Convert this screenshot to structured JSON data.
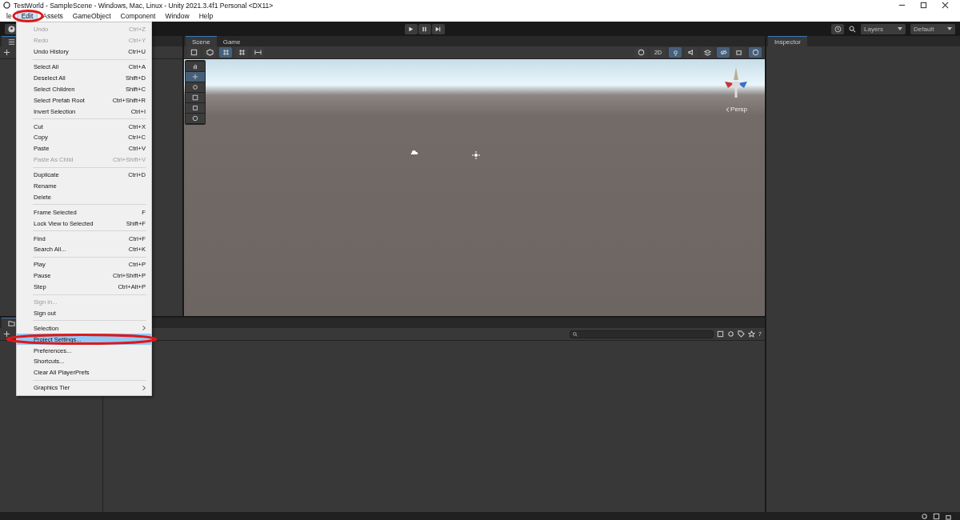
{
  "window": {
    "title": "TestWorld - SampleScene - Windows, Mac, Linux - Unity 2021.3.4f1 Personal <DX11>"
  },
  "menu_bar": [
    {
      "label": "le",
      "selected": false
    },
    {
      "label": "Edit",
      "selected": true
    },
    {
      "label": "Assets",
      "selected": false
    },
    {
      "label": "GameObject",
      "selected": false
    },
    {
      "label": "Component",
      "selected": false
    },
    {
      "label": "Window",
      "selected": false
    },
    {
      "label": "Help",
      "selected": false
    }
  ],
  "toolbar": {
    "layers": "Layers",
    "layout": "Default"
  },
  "scene_tabs": [
    {
      "label": "Scene",
      "selected": true
    },
    {
      "label": "Game",
      "selected": false
    }
  ],
  "scene_view": {
    "toolbar_2d": "2D",
    "camera_label": "Persp"
  },
  "inspector": {
    "tab": "Inspector"
  },
  "edit_menu": [
    {
      "kind": "item",
      "label": "Undo",
      "shortcut": "Ctrl+Z",
      "disabled": true,
      "selected": false
    },
    {
      "kind": "item",
      "label": "Redo",
      "shortcut": "Ctrl+Y",
      "disabled": true,
      "selected": false
    },
    {
      "kind": "item",
      "label": "Undo History",
      "shortcut": "Ctrl+U",
      "disabled": false,
      "selected": false
    },
    {
      "kind": "separator"
    },
    {
      "kind": "item",
      "label": "Select All",
      "shortcut": "Ctrl+A",
      "disabled": false,
      "selected": false
    },
    {
      "kind": "item",
      "label": "Deselect All",
      "shortcut": "Shift+D",
      "disabled": false,
      "selected": false
    },
    {
      "kind": "item",
      "label": "Select Children",
      "shortcut": "Shift+C",
      "disabled": false,
      "selected": false
    },
    {
      "kind": "item",
      "label": "Select Prefab Root",
      "shortcut": "Ctrl+Shift+R",
      "disabled": false,
      "selected": false
    },
    {
      "kind": "item",
      "label": "Invert Selection",
      "shortcut": "Ctrl+I",
      "disabled": false,
      "selected": false
    },
    {
      "kind": "separator"
    },
    {
      "kind": "item",
      "label": "Cut",
      "shortcut": "Ctrl+X",
      "disabled": false,
      "selected": false
    },
    {
      "kind": "item",
      "label": "Copy",
      "shortcut": "Ctrl+C",
      "disabled": false,
      "selected": false
    },
    {
      "kind": "item",
      "label": "Paste",
      "shortcut": "Ctrl+V",
      "disabled": false,
      "selected": false
    },
    {
      "kind": "item",
      "label": "Paste As Child",
      "shortcut": "Ctrl+Shift+V",
      "disabled": true,
      "selected": false
    },
    {
      "kind": "separator"
    },
    {
      "kind": "item",
      "label": "Duplicate",
      "shortcut": "Ctrl+D",
      "disabled": false,
      "selected": false
    },
    {
      "kind": "item",
      "label": "Rename",
      "disabled": false,
      "selected": false
    },
    {
      "kind": "item",
      "label": "Delete",
      "disabled": false,
      "selected": false
    },
    {
      "kind": "separator"
    },
    {
      "kind": "item",
      "label": "Frame Selected",
      "shortcut": "F",
      "disabled": false,
      "selected": false
    },
    {
      "kind": "item",
      "label": "Lock View to Selected",
      "shortcut": "Shift+F",
      "disabled": false,
      "selected": false
    },
    {
      "kind": "separator"
    },
    {
      "kind": "item",
      "label": "Find",
      "shortcut": "Ctrl+F",
      "disabled": false,
      "selected": false
    },
    {
      "kind": "item",
      "label": "Search All...",
      "shortcut": "Ctrl+K",
      "disabled": false,
      "selected": false
    },
    {
      "kind": "separator"
    },
    {
      "kind": "item",
      "label": "Play",
      "shortcut": "Ctrl+P",
      "disabled": false,
      "selected": false
    },
    {
      "kind": "item",
      "label": "Pause",
      "shortcut": "Ctrl+Shift+P",
      "disabled": false,
      "selected": false
    },
    {
      "kind": "item",
      "label": "Step",
      "shortcut": "Ctrl+Alt+P",
      "disabled": false,
      "selected": false
    },
    {
      "kind": "separator"
    },
    {
      "kind": "item",
      "label": "Sign in...",
      "disabled": true,
      "selected": false
    },
    {
      "kind": "item",
      "label": "Sign out",
      "disabled": false,
      "selected": false
    },
    {
      "kind": "separator"
    },
    {
      "kind": "submenu",
      "label": "Selection",
      "disabled": false,
      "selected": false
    },
    {
      "kind": "item",
      "label": "Project Settings...",
      "disabled": false,
      "selected": true
    },
    {
      "kind": "item",
      "label": "Preferences...",
      "disabled": false,
      "selected": false
    },
    {
      "kind": "item",
      "label": "Shortcuts...",
      "disabled": false,
      "selected": false
    },
    {
      "kind": "item",
      "label": "Clear All PlayerPrefs",
      "disabled": false,
      "selected": false
    },
    {
      "kind": "separator"
    },
    {
      "kind": "submenu",
      "label": "Graphics Tier",
      "disabled": false,
      "selected": false
    }
  ],
  "project_panel": {
    "badge": "7"
  }
}
